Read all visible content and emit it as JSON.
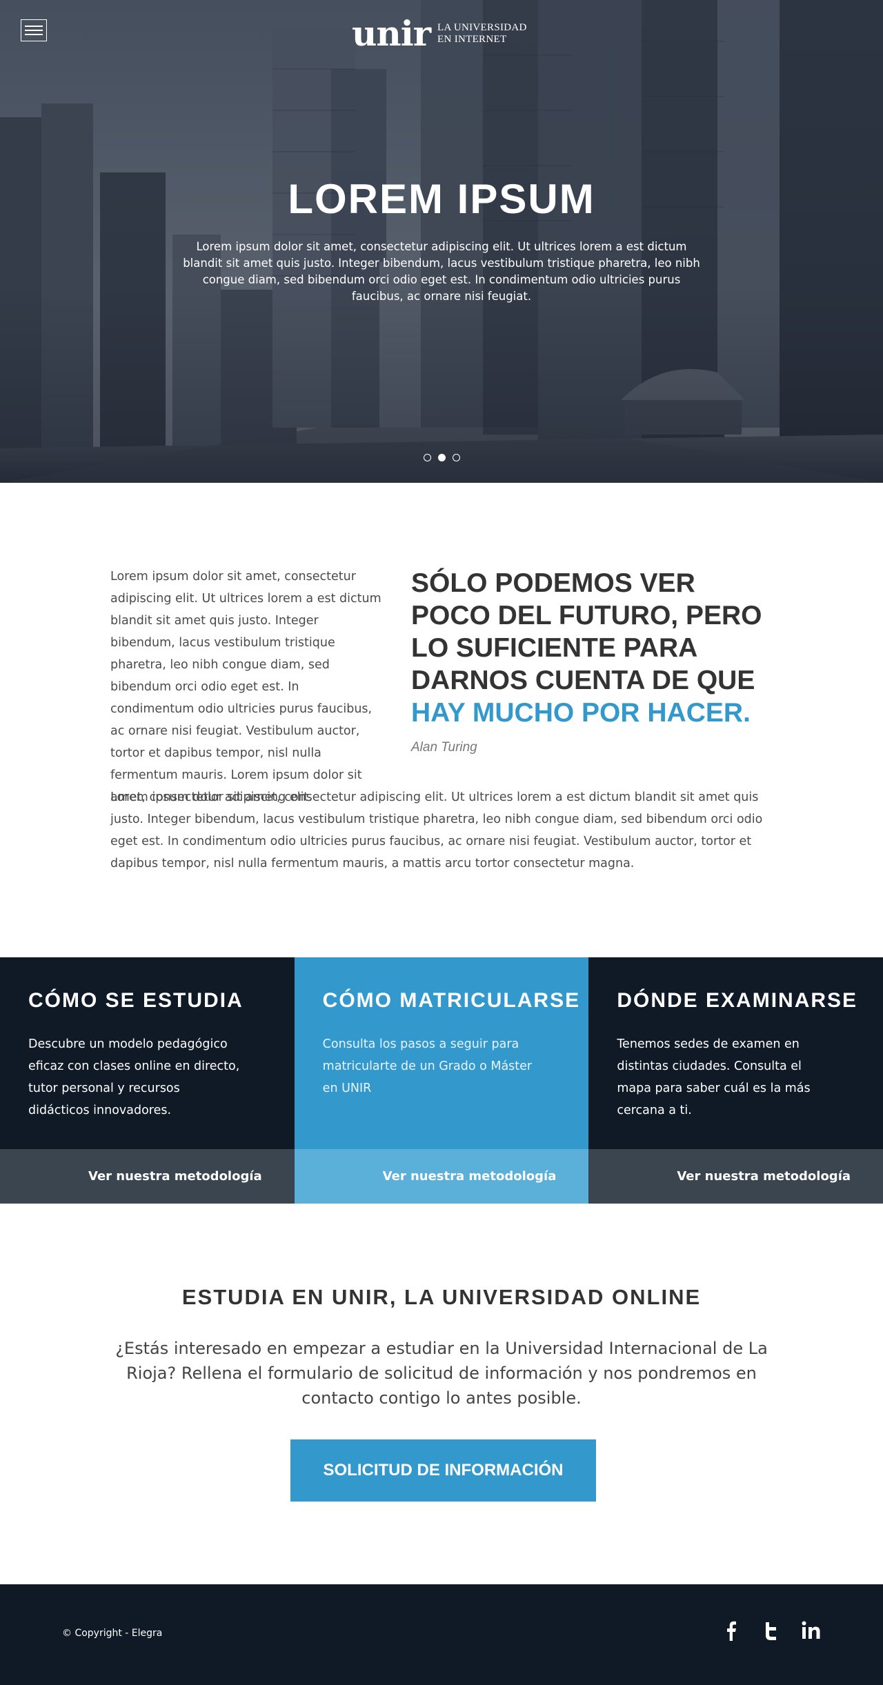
{
  "header": {
    "logo_mark": "unir",
    "logo_line1": "LA UNIVERSIDAD",
    "logo_line2": "EN INTERNET"
  },
  "hero": {
    "title": "LOREM IPSUM",
    "text": "Lorem ipsum dolor sit amet, consectetur adipiscing elit. Ut ultrices lorem a est dictum blandit sit amet quis justo. Integer bibendum, lacus vestibulum tristique pharetra, leo nibh congue diam, sed bibendum orci odio eget est. In condimentum odio ultricies purus faucibus, ac ornare nisi feugiat.",
    "slides": 3,
    "active_slide": 2
  },
  "intro": {
    "left_text": "Lorem ipsum dolor sit amet, consectetur adipiscing elit. Ut ultrices lorem a est dictum blandit sit amet quis justo. Integer bibendum, lacus vestibulum tristique pharetra, leo nibh congue diam, sed bibendum orci odio eget est. In condimentum odio ultricies purus faucibus, ac ornare nisi feugiat. Vestibulum auctor, tortor et dapibus tempor, nisl nulla fermentum mauris. Lorem ipsum dolor sit amet, consectetur adipiscing elit.",
    "quote_main": "SÓLO PODEMOS VER POCO DEL FUTURO, PERO LO SUFICIENTE PARA DARNOS CUENTA DE QUE ",
    "quote_highlight": "HAY MUCHO POR HACER.",
    "author": "Alan Turing",
    "full_text": "Lorem ipsum dolor sit amet, consectetur adipiscing elit. Ut ultrices lorem a est dictum blandit sit amet quis justo. Integer bibendum, lacus vestibulum tristique pharetra, leo nibh congue diam, sed bibendum orci odio eget est. In condimentum odio ultricies purus faucibus, ac ornare nisi feugiat. Vestibulum auctor, tortor et dapibus tempor, nisl nulla fermentum mauris, a mattis arcu tortor consectetur magna."
  },
  "features": [
    {
      "title": "CÓMO SE ESTUDIA",
      "text": "Descubre un modelo pedagógico eficaz con clases online en directo, tutor personal y recursos didácticos innovadores.",
      "cta": "Ver nuestra metodología"
    },
    {
      "title": "CÓMO MATRICULARSE",
      "text": "Consulta los pasos a seguir para matricularte de un Grado o Máster en UNIR",
      "cta": "Ver nuestra metodología"
    },
    {
      "title": "DÓNDE EXAMINARSE",
      "text": "Tenemos sedes de examen en distintas ciudades. Consulta el mapa para saber cuál es la más cercana a ti.",
      "cta": "Ver nuestra metodología"
    }
  ],
  "signup": {
    "title": "ESTUDIA EN UNIR, LA UNIVERSIDAD ONLINE",
    "text": "¿Estás interesado en empezar a estudiar en la Universidad Internacional de La Rioja? Rellena el formulario de solicitud de información y nos pondremos en contacto contigo lo antes posible.",
    "button": "SOLICITUD DE INFORMACIÓN"
  },
  "footer": {
    "copyright": "© Copyright - Elegra",
    "social": [
      "facebook-icon",
      "twitter-icon",
      "linkedin-icon"
    ]
  },
  "colors": {
    "accent": "#3399cc",
    "dark": "#0f1a26",
    "cta_bar": "#3a4550"
  }
}
